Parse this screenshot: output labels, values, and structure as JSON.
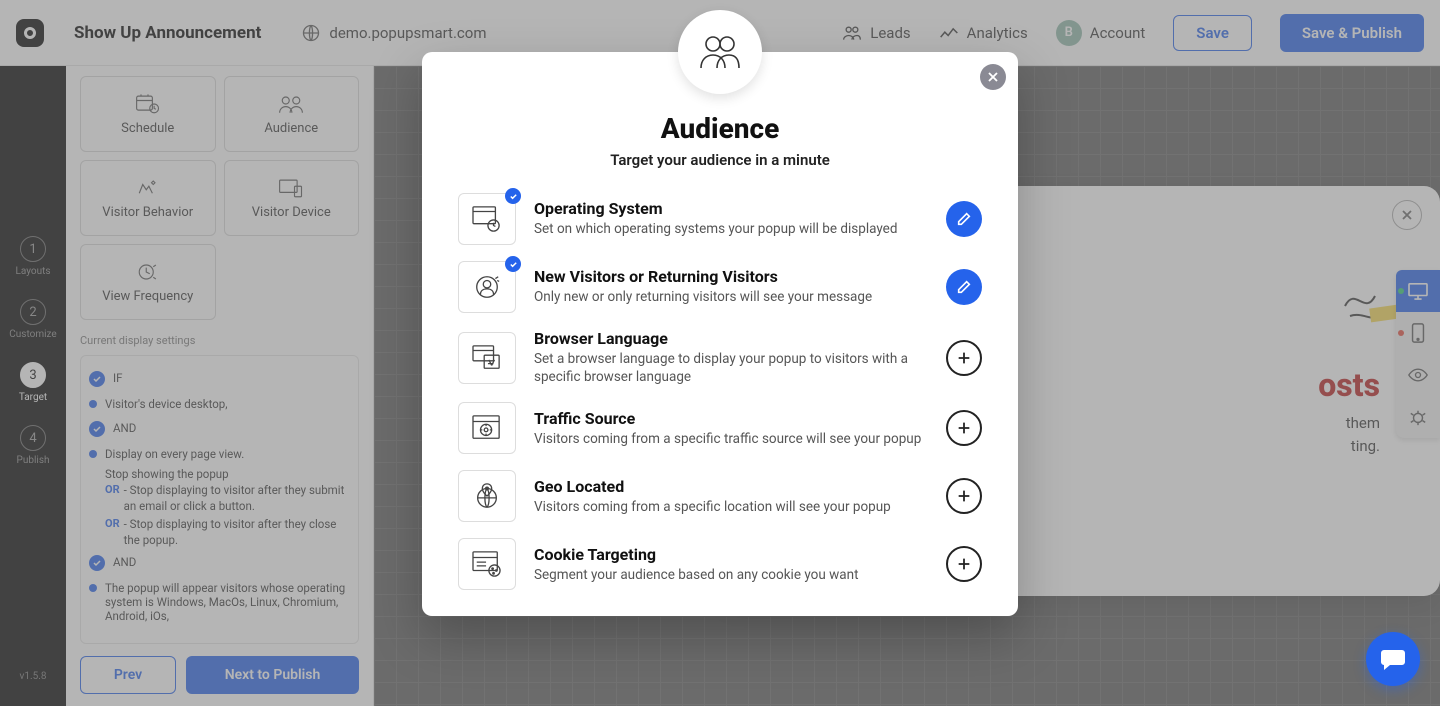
{
  "topbar": {
    "page_title": "Show Up Announcement",
    "domain": "demo.popupsmart.com",
    "nav_leads": "Leads",
    "nav_analytics": "Analytics",
    "nav_account": "Account",
    "account_initial": "B",
    "save": "Save",
    "save_publish": "Save & Publish"
  },
  "steps": [
    {
      "num": "1",
      "label": "Layouts"
    },
    {
      "num": "2",
      "label": "Customize"
    },
    {
      "num": "3",
      "label": "Target"
    },
    {
      "num": "4",
      "label": "Publish"
    }
  ],
  "version": "v1.5.8",
  "target_cards": {
    "schedule": "Schedule",
    "audience": "Audience",
    "visitor_behavior": "Visitor Behavior",
    "visitor_device": "Visitor Device",
    "view_frequency": "View Frequency"
  },
  "settings_label": "Current display settings",
  "rules": {
    "if": "IF",
    "device": "Visitor's device desktop,",
    "and": "AND",
    "every_view": "Display on every page view.",
    "stop_heading": "Stop showing the popup",
    "or": "OR",
    "stop1": "- Stop displaying to visitor after they submit an email or click a button.",
    "stop2": "- Stop displaying to visitor after they close the popup.",
    "os_rule": "The popup will appear visitors whose operating system is Windows, MacOs, Linux, Chromium, Android, iOs,"
  },
  "bottom": {
    "prev": "Prev",
    "next": "Next to Publish"
  },
  "modal": {
    "title": "Audience",
    "subtitle": "Target your audience in a minute",
    "options": [
      {
        "key": "os",
        "title": "Operating System",
        "desc": "Set on which operating systems your popup will be displayed",
        "active": true
      },
      {
        "key": "visitors",
        "title": "New Visitors or Returning Visitors",
        "desc": "Only new or only returning visitors will see your message",
        "active": true
      },
      {
        "key": "lang",
        "title": "Browser Language",
        "desc": "Set a browser language to display your popup to visitors with a specific browser language",
        "active": false
      },
      {
        "key": "traffic",
        "title": "Traffic Source",
        "desc": "Visitors coming from a specific traffic source will see your popup",
        "active": false
      },
      {
        "key": "geo",
        "title": "Geo Located",
        "desc": "Visitors coming from a specific location will see your popup",
        "active": false
      },
      {
        "key": "cookie",
        "title": "Cookie Targeting",
        "desc": "Segment your audience based on any cookie you want",
        "active": false
      }
    ]
  },
  "preview": {
    "title_fragment": "osts",
    "body_line1": "them",
    "body_line2": "ting."
  }
}
